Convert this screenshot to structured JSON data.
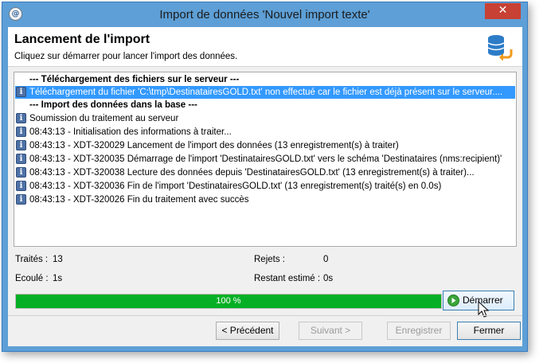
{
  "window": {
    "title": "Import de données 'Nouvel import texte'",
    "close_glyph": "✕",
    "app_icon": "app-icon"
  },
  "header": {
    "title": "Lancement de l'import",
    "subtitle": "Cliquez sur démarrer pour lancer l'import des données."
  },
  "log": {
    "rows": [
      {
        "type": "section",
        "text": "--- Téléchargement des fichiers sur le serveur ---"
      },
      {
        "type": "selected",
        "text": "Téléchargement du fichier 'C:\\tmp\\DestinatairesGOLD.txt' non effectué car le fichier est déjà présent sur le serveur...."
      },
      {
        "type": "section",
        "text": "--- Import des données dans la base ---"
      },
      {
        "type": "info",
        "text": "Soumission du traitement au serveur"
      },
      {
        "type": "info",
        "text": "08:43:13 - Initialisation des informations à traiter..."
      },
      {
        "type": "info",
        "text": "08:43:13 - XDT-320029 Lancement de l'import des données (13 enregistrement(s) à traiter)"
      },
      {
        "type": "info",
        "text": "08:43:13 - XDT-320035 Démarrage de l'import 'DestinatairesGOLD.txt' vers le schéma 'Destinataires (nms:recipient)'"
      },
      {
        "type": "info",
        "text": "08:43:13 - XDT-320038 Lecture des données depuis 'DestinatairesGOLD.txt' (13 enregistrement(s) à traiter)..."
      },
      {
        "type": "info",
        "text": "08:43:13 - XDT-320036 Fin de l'import 'DestinatairesGOLD.txt' (13 enregistrement(s) traité(s) en 0.0s)"
      },
      {
        "type": "info",
        "text": "08:43:13 - XDT-320026 Fin du traitement avec succès"
      }
    ]
  },
  "stats": {
    "processed_label": "Traités :",
    "processed_value": "13",
    "rejected_label": "Rejets :",
    "rejected_value": "0",
    "elapsed_label": "Ecoulé :",
    "elapsed_value": "1s",
    "remaining_label": "Restant estimé :",
    "remaining_value": "0s"
  },
  "progress": {
    "percent": 100,
    "label": "100 %",
    "color": "#06b025"
  },
  "buttons": {
    "start_label": "Démarrer",
    "previous_label": "< Précédent",
    "next_label": "Suivant >",
    "save_label": "Enregistrer",
    "close_label": "Fermer"
  }
}
